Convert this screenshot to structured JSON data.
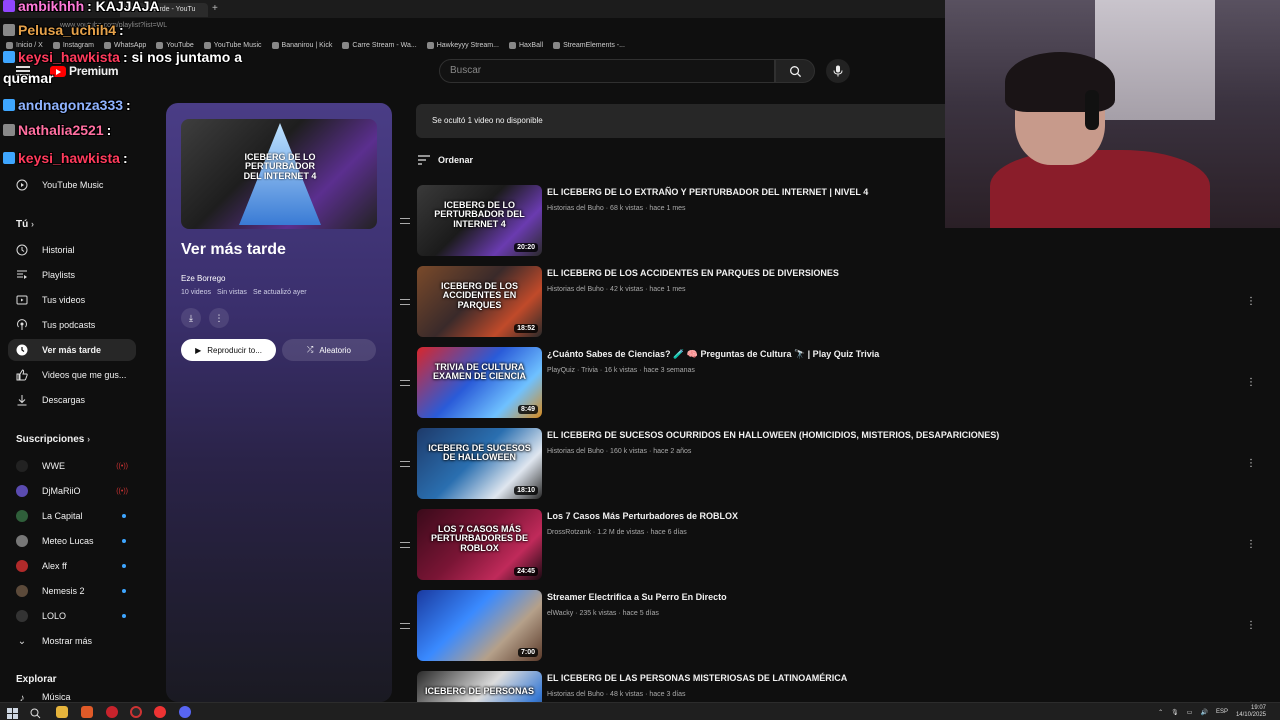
{
  "browser": {
    "tab_title": "Ver más tarde - YouTu",
    "new_tab": "+",
    "url": "www.youtube.com/playlist?list=WL",
    "bookmarks": [
      "Inicio / X",
      "Instagram",
      "WhatsApp",
      "YouTube",
      "YouTube Music",
      "Bananirou | Kick",
      "Carre Stream - Wa...",
      "Hawkeyyy Stream...",
      "HaxBall",
      "StreamElements -..."
    ]
  },
  "header": {
    "logo_text": "Premium",
    "search_placeholder": "Buscar"
  },
  "sidebar": {
    "top_items": [
      {
        "label": "YouTube Music",
        "icon": "youtube-music-icon"
      }
    ],
    "you_heading": "Tú",
    "you_items": [
      {
        "label": "Historial",
        "icon": "history-icon"
      },
      {
        "label": "Playlists",
        "icon": "playlists-icon"
      },
      {
        "label": "Tus videos",
        "icon": "your-videos-icon"
      },
      {
        "label": "Tus podcasts",
        "icon": "podcasts-icon"
      },
      {
        "label": "Ver más tarde",
        "icon": "watch-later-icon",
        "active": true
      },
      {
        "label": "Videos que me gus...",
        "icon": "like-icon"
      },
      {
        "label": "Descargas",
        "icon": "download-icon"
      }
    ],
    "subs_heading": "Suscripciones",
    "subscriptions": [
      {
        "label": "WWE",
        "status": "live",
        "color": "#222222"
      },
      {
        "label": "DjMaRiiO",
        "status": "live",
        "color": "#5a4bb0"
      },
      {
        "label": "La Capital",
        "status": "new",
        "color": "#2f5f3a"
      },
      {
        "label": "Meteo Lucas",
        "status": "new",
        "color": "#777777"
      },
      {
        "label": "Alex ff",
        "status": "new",
        "color": "#b02a2a"
      },
      {
        "label": "Nemesis 2",
        "status": "new",
        "color": "#5c4a3a"
      },
      {
        "label": "LOLO",
        "status": "new",
        "color": "#333333"
      }
    ],
    "show_more": "Mostrar más",
    "explore_heading": "Explorar",
    "explore_partial": "Música"
  },
  "playlist": {
    "cover_text": "ICEBERG DE LO PERTURBADOR DEL INTERNET 4",
    "title": "Ver más tarde",
    "owner": "Eze Borrego",
    "count": "10 videos",
    "views": "Sin vistas",
    "updated": "Se actualizó ayer",
    "play_label": "Reproducir to...",
    "shuffle_label": "Aleatorio"
  },
  "main": {
    "notice": "Se ocultó 1 video no disponible",
    "sort_label": "Ordenar",
    "videos": [
      {
        "title": "EL ICEBERG DE LO EXTRAÑO Y PERTURBADOR DEL INTERNET | NIVEL 4",
        "channel": "Historias del Buho",
        "views": "68 k vistas",
        "age": "hace 1 mes",
        "duration": "20:20",
        "thumb_text": "ICEBERG DE LO PERTURBADOR DEL INTERNET 4",
        "bg": "linear-gradient(135deg,#3a3a3a,#1b1b1b 45%,#6a3bb0 75%,#2a2a2a)"
      },
      {
        "title": "EL ICEBERG DE LOS ACCIDENTES EN PARQUES DE DIVERSIONES",
        "channel": "Historias del Buho",
        "views": "42 k vistas",
        "age": "hace 1 mes",
        "duration": "18:52",
        "thumb_text": "ICEBERG DE LOS ACCIDENTES EN PARQUES",
        "bg": "linear-gradient(135deg,#7a4a2a,#3a2a2a 45%,#c04a2a 75%,#2a2a2a)"
      },
      {
        "title": "¿Cuánto Sabes de Ciencias? 🧪 🧠 Preguntas de Cultura 🔭 | Play Quiz Trivia",
        "channel": "PlayQuiz · Trivia",
        "views": "16 k vistas",
        "age": "hace 3 semanas",
        "duration": "8:49",
        "thumb_text": "TRIVIA DE CULTURA EXAMEN DE CIENCIA",
        "bg": "linear-gradient(135deg,#d9262b,#2a5bd8 45%,#6fc1ff 75%,#d68a1e)"
      },
      {
        "title": "EL ICEBERG DE SUCESOS OCURRIDOS EN HALLOWEEN (HOMICIDIOS, MISTERIOS, DESAPARICIONES)",
        "channel": "Historias del Buho",
        "views": "160 k vistas",
        "age": "hace 2 años",
        "duration": "18:10",
        "thumb_text": "ICEBERG DE SUCESOS DE HALLOWEEN",
        "bg": "linear-gradient(135deg,#1e3a6a,#2a6fb0 45%,#dfe6ef 75%,#2a2a2a)"
      },
      {
        "title": "Los 7 Casos Más Perturbadores de ROBLOX",
        "channel": "DrossRotzank",
        "views": "1.2 M de vistas",
        "age": "hace 6 días",
        "duration": "24:45",
        "thumb_text": "LOS 7 CASOS MÁS PERTURBADORES DE ROBLOX",
        "bg": "linear-gradient(135deg,#3a0a1a,#7a1535 45%,#c02a5a 75%,#1a0a12)"
      },
      {
        "title": "Streamer Electrifica a Su Perro En Directo",
        "channel": "elWacky",
        "views": "235 k vistas",
        "age": "hace 5 días",
        "duration": "7:00",
        "thumb_text": "",
        "bg": "linear-gradient(135deg,#1a3aa0,#3a8aff 40%,#b5a08a 70%,#5a3a2a)"
      },
      {
        "title": "EL ICEBERG DE LAS PERSONAS MISTERIOSAS DE LATINOAMÉRICA",
        "channel": "Historias del Buho",
        "views": "48 k vistas",
        "age": "hace 3 días",
        "duration": "",
        "thumb_text": "ICEBERG DE PERSONAS",
        "bg": "linear-gradient(135deg,#2a2a2a,#dcdcdc 45%,#3a7bd5 75%,#1a1a1a)"
      }
    ]
  },
  "chat": [
    {
      "user": "ambikhhh",
      "msg": ": KAJJAJA",
      "color": "#ff7ad9"
    },
    {
      "user": "Pelusa_uchih4",
      "msg": ":",
      "color": "#e6a24a"
    },
    {
      "user": "keysi_hawkista",
      "msg": ": si nos juntamo a",
      "color": "#ff3b5c"
    },
    {
      "user": "",
      "msg": "quemar",
      "color": "#ffffff"
    },
    {
      "user": "andnagonza333",
      "msg": ":",
      "color": "#8fb3ff"
    },
    {
      "user": "Nathalia2521",
      "msg": ":",
      "color": "#ff6fa0"
    },
    {
      "user": "keysi_hawkista",
      "msg": ":",
      "color": "#ff3b5c"
    }
  ],
  "taskbar": {
    "lang": "ESP",
    "time": "19:07",
    "date": "14/10/2025"
  }
}
